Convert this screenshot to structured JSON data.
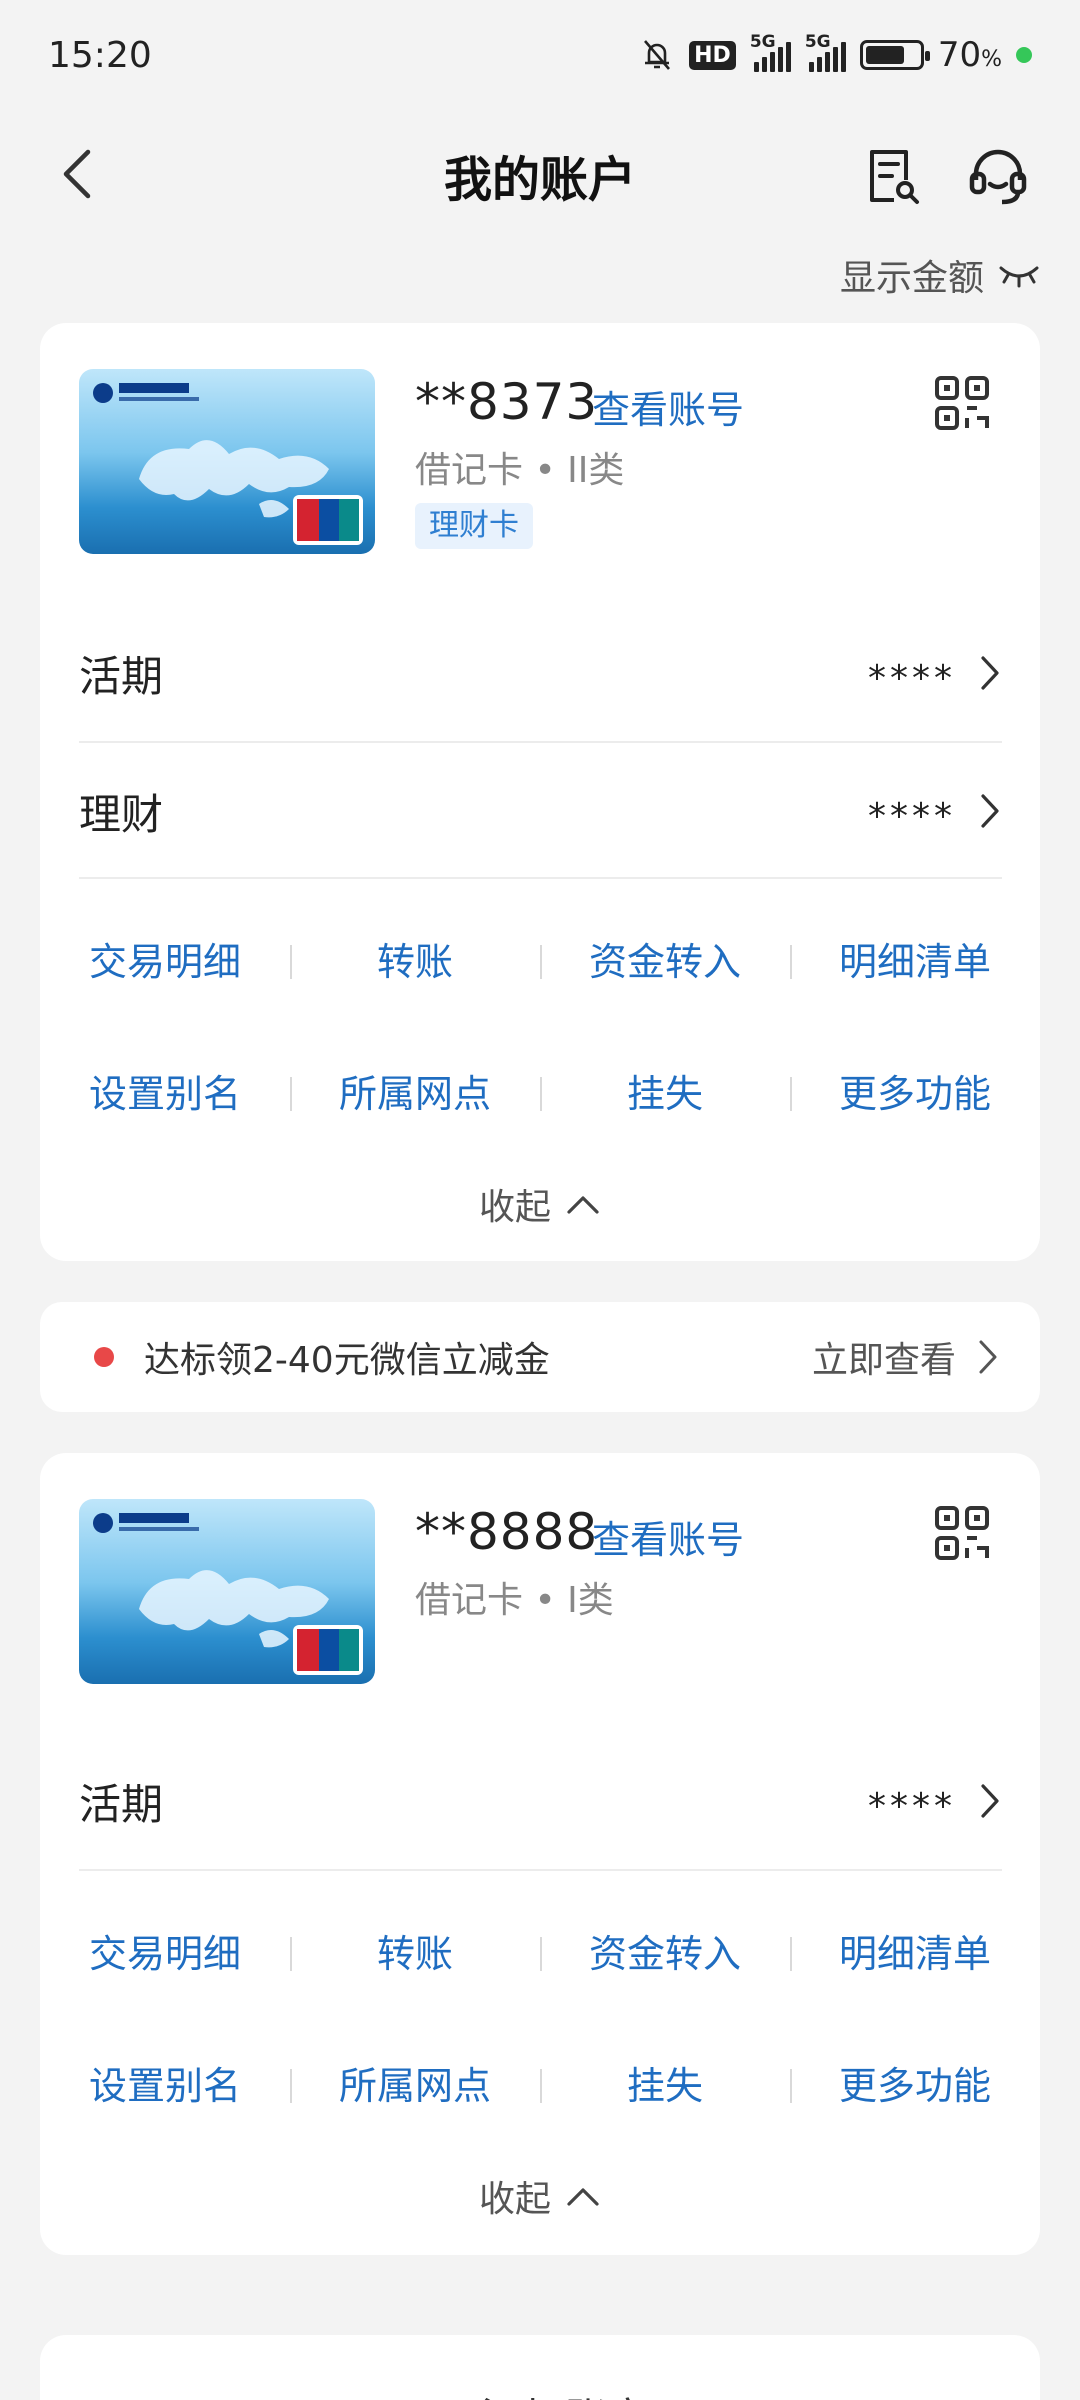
{
  "status_bar": {
    "time": "15:20",
    "hd_label": "HD",
    "sim1_label": "5G",
    "sim2_label": "5G",
    "battery_percent": "70",
    "battery_unit": "%",
    "battery_level": 0.7
  },
  "nav": {
    "title": "我的账户",
    "back_icon": "chevron-left-icon",
    "record_icon": "document-search-icon",
    "service_icon": "headset-icon"
  },
  "show_amount": {
    "label": "显示金额",
    "icon": "eye-closed-icon"
  },
  "accounts": [
    {
      "number": "**8373",
      "view_label": "查看账号",
      "type": "借记卡 • II类",
      "tag": "理财卡",
      "rows": [
        {
          "label": "活期",
          "value": "****"
        },
        {
          "label": "理财",
          "value": "****"
        }
      ],
      "actions_row1": [
        "交易明细",
        "转账",
        "资金转入",
        "明细清单"
      ],
      "actions_row2": [
        "设置别名",
        "所属网点",
        "挂失",
        "更多功能"
      ],
      "collapse_label": "收起"
    },
    {
      "number": "**8888",
      "view_label": "查看账号",
      "type": "借记卡 • I类",
      "rows": [
        {
          "label": "活期",
          "value": "****"
        }
      ],
      "actions_row1": [
        "交易明细",
        "转账",
        "资金转入",
        "明细清单"
      ],
      "actions_row2": [
        "设置别名",
        "所属网点",
        "挂失",
        "更多功能"
      ],
      "collapse_label": "收起"
    }
  ],
  "promo": {
    "text": "达标领2-40元微信立减金",
    "link": "立即查看"
  },
  "add_account": {
    "label": "添加账户"
  },
  "colors": {
    "accent": "#1f6dc1",
    "background": "#f3f3f3",
    "promo_dot": "#e84848"
  }
}
